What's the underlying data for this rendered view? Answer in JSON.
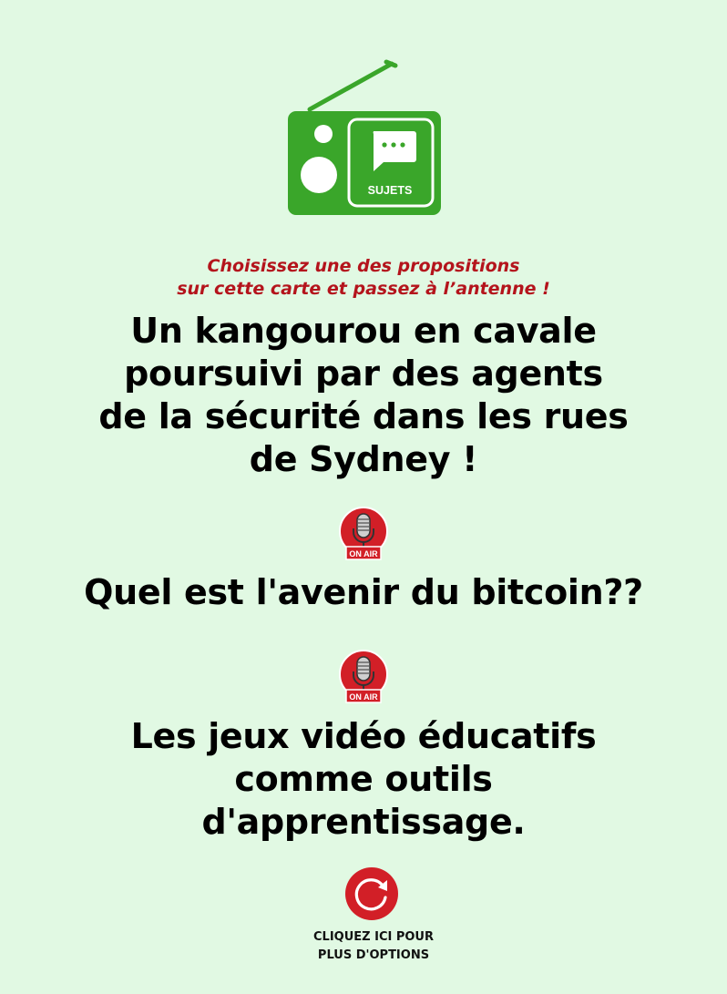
{
  "logo": {
    "label": "SUJETS",
    "icon": "radio-icon",
    "color": "#3aa62a"
  },
  "instruction": {
    "line1": "Choisissez une des propositions",
    "line2": "sur cette carte et passez à l’antenne !",
    "color": "#b4141c"
  },
  "topics": [
    {
      "lines": [
        "Un kangourou en cavale",
        "poursuivi par des agents",
        "de la sécurité dans les rues",
        "de Sydney !"
      ]
    },
    {
      "lines": [
        "Quel est l'avenir du bitcoin??"
      ]
    },
    {
      "lines": [
        "Les jeux vidéo éducatifs",
        "comme outils",
        "d'apprentissage."
      ]
    }
  ],
  "badges": {
    "on_air_label": "ON AIR",
    "icon": "microphone-icon",
    "color": "#d21f27"
  },
  "more_options": {
    "line1": "CLIQUEZ ICI POUR",
    "line2": "PLUS D'OPTIONS",
    "icon": "refresh-icon"
  },
  "background": "#e1f9e3"
}
